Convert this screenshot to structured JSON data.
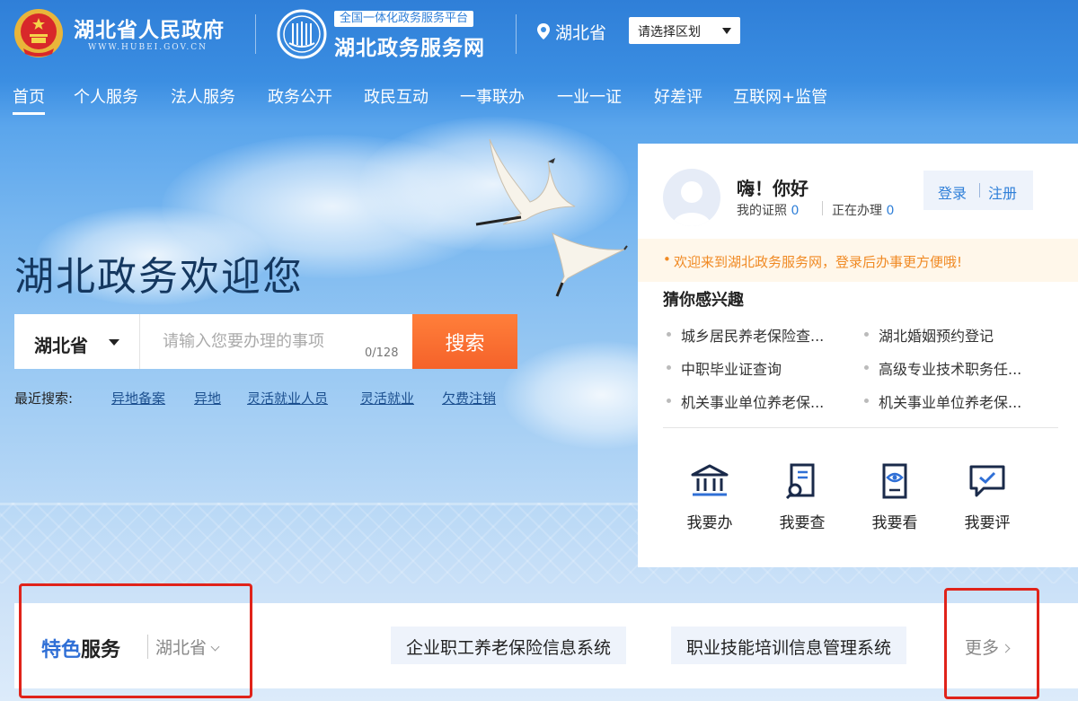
{
  "header": {
    "gov_title": "湖北省人民政府",
    "gov_url": "WWW.HUBEI.GOV.CN",
    "platform_tag": "全国一体化政务服务平台",
    "service_title": "湖北政务服务网",
    "location": "湖北省",
    "region_select": "请选择区划"
  },
  "nav": [
    {
      "label": "首页",
      "active": true
    },
    {
      "label": "个人服务"
    },
    {
      "label": "法人服务"
    },
    {
      "label": "政务公开"
    },
    {
      "label": "政民互动"
    },
    {
      "label": "一事联办"
    },
    {
      "label": "一业一证"
    },
    {
      "label": "好差评"
    },
    {
      "label": "互联网+监管"
    }
  ],
  "hero": {
    "title": "湖北政务欢迎您",
    "search_scope": "湖北省",
    "search_placeholder": "请输入您要办理的事项",
    "search_count": "0/128",
    "search_button": "搜索",
    "recent_label": "最近搜索:",
    "recent": [
      "异地备案",
      "异地",
      "灵活就业人员",
      "灵活就业",
      "欠费注销"
    ]
  },
  "card": {
    "greeting": "嗨！你好",
    "my_licenses_label": "我的证照",
    "my_licenses_count": "0",
    "in_progress_label": "正在办理",
    "in_progress_count": "0",
    "login": "登录",
    "register": "注册",
    "notice": "欢迎来到湖北政务服务网，登录后办事更方便哦!",
    "interest_title": "猜你感兴趣",
    "interests": [
      "城乡居民养老保险查...",
      "湖北婚姻预约登记",
      "中职毕业证查询",
      "高级专业技术职务任...",
      "机关事业单位养老保...",
      "机关事业单位养老保..."
    ],
    "actions": [
      {
        "label": "我要办",
        "icon": "bank-icon"
      },
      {
        "label": "我要查",
        "icon": "search-doc-icon"
      },
      {
        "label": "我要看",
        "icon": "eye-doc-icon"
      },
      {
        "label": "我要评",
        "icon": "chat-check-icon"
      }
    ]
  },
  "feature": {
    "title_blue": "特色",
    "title_black": "服务",
    "region": "湖北省",
    "systems": [
      "企业职工养老保险信息系统",
      "职业技能培训信息管理系统"
    ],
    "more": "更多"
  },
  "colors": {
    "brand_blue": "#2f7fd8",
    "search_orange": "#f5622a",
    "notice_orange": "#f08a24",
    "highlight_red": "#e0231a"
  }
}
